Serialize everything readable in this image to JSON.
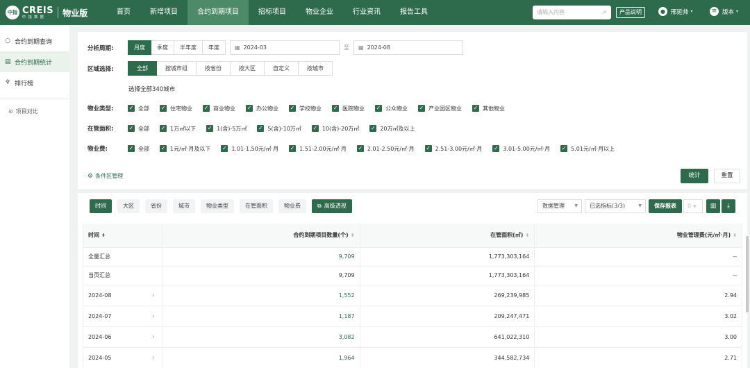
{
  "brand": {
    "logo_mark": "中指",
    "logo_main": "CREIS",
    "logo_sub": "中 指 数 据",
    "product": "物业版"
  },
  "nav": [
    {
      "label": "首页",
      "active": false
    },
    {
      "label": "新增项目",
      "active": false
    },
    {
      "label": "合约到期项目",
      "active": true
    },
    {
      "label": "招标项目",
      "active": false
    },
    {
      "label": "物业企业",
      "active": false
    },
    {
      "label": "行业资讯",
      "active": false
    },
    {
      "label": "报告工具",
      "active": false
    }
  ],
  "header": {
    "search_placeholder": "请输入内容",
    "manual_label": "产品说明",
    "user_name": "邢延帅",
    "version_label": "版本"
  },
  "sidebar": {
    "items": [
      {
        "label": "合约到期查询",
        "icon": "search-icon",
        "active": false
      },
      {
        "label": "合约到期统计",
        "icon": "stats-icon",
        "active": true
      },
      {
        "label": "排行榜",
        "icon": "trophy-icon",
        "active": false
      }
    ],
    "compare_label": "项目对比"
  },
  "filters": {
    "period": {
      "label": "分析周期:",
      "options": [
        "月度",
        "季度",
        "半年度",
        "年度"
      ],
      "active": "月度",
      "start": "2024-03",
      "separator": "至",
      "end": "2024-08"
    },
    "region": {
      "label": "区域选择:",
      "options": [
        "全部",
        "按城市组",
        "按省份",
        "按大区",
        "自定义",
        "按城市"
      ],
      "active": "全部",
      "selected_text": "选择全部340城市"
    },
    "property_type": {
      "label": "物业类型:",
      "options": [
        "全部",
        "住宅物业",
        "商业物业",
        "办公物业",
        "学校物业",
        "医院物业",
        "公众物业",
        "产业园区物业",
        "其他物业"
      ]
    },
    "managed_area": {
      "label": "在管面积:",
      "options": [
        "全部",
        "1万㎡以下",
        "1(含)-5万㎡",
        "5(含)-10万㎡",
        "10(含)-20万㎡",
        "20万㎡及以上"
      ]
    },
    "fee": {
      "label": "物业费:",
      "options": [
        "全部",
        "1元/㎡·月及以下",
        "1.01-1.50元/㎡·月",
        "1.51-2.00元/㎡·月",
        "2.01-2.50元/㎡·月",
        "2.51-3.00元/㎡·月",
        "3.01-5.00元/㎡·月",
        "5.01元/㎡·月以上"
      ]
    },
    "condition_link": "条件区管理",
    "stat_button": "统计",
    "reset_button": "重置"
  },
  "data_panel": {
    "dimensions": [
      {
        "label": "时间",
        "active": true
      },
      {
        "label": "大区",
        "active": false
      },
      {
        "label": "省份",
        "active": false
      },
      {
        "label": "城市",
        "active": false
      },
      {
        "label": "物业类型",
        "active": false
      },
      {
        "label": "在管面积",
        "active": false
      },
      {
        "label": "物业费",
        "active": false
      }
    ],
    "advanced_label": "高级透视",
    "data_mgmt": "数据管理",
    "selected_metrics": "已选指标(3/3)",
    "save_report": "保存报表",
    "saved_count": "0",
    "table": {
      "columns": [
        "时间",
        "合约到期项目数量(个)",
        "在管面积(㎡)",
        "物业管理费(元/㎡·月)"
      ],
      "rows": [
        {
          "period": "全量汇总",
          "count": "9,709",
          "area": "1,773,303,164",
          "fee": "--",
          "expandable": false,
          "link": true
        },
        {
          "period": "当页汇总",
          "count": "9,709",
          "area": "1,773,303,164",
          "fee": "--",
          "expandable": false,
          "link": false
        },
        {
          "period": "2024-08",
          "count": "1,552",
          "area": "269,239,985",
          "fee": "2.94",
          "expandable": true,
          "link": true
        },
        {
          "period": "2024-07",
          "count": "1,187",
          "area": "209,247,471",
          "fee": "3.02",
          "expandable": true,
          "link": true
        },
        {
          "period": "2024-06",
          "count": "3,082",
          "area": "641,022,310",
          "fee": "3.00",
          "expandable": true,
          "link": true
        },
        {
          "period": "2024-05",
          "count": "1,964",
          "area": "344,582,734",
          "fee": "2.71",
          "expandable": true,
          "link": true
        }
      ]
    }
  },
  "colors": {
    "brand": "#2e6b4c",
    "nav_active": "#4d8a68"
  }
}
